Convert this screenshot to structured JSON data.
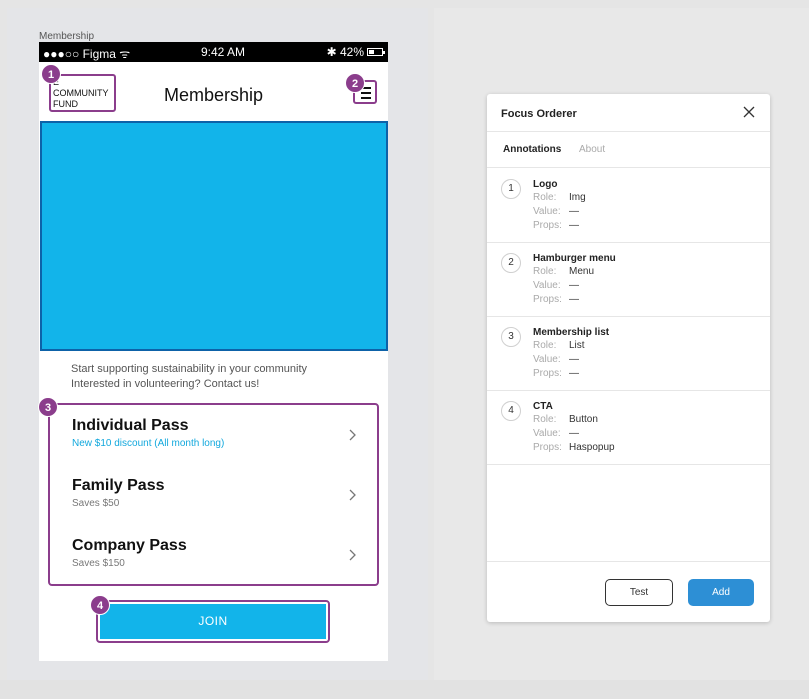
{
  "frame_label": "Membership",
  "statusbar": {
    "carrier": "●●●○○ Figma ᯤ",
    "time": "9:42 AM",
    "battery": "✱ 42%",
    "battery_level": 0.42
  },
  "header": {
    "logo_lines": [
      "E",
      "COMMUNITY",
      "FUND"
    ],
    "title": "Membership"
  },
  "intro": {
    "line1": "Start supporting sustainability in your community",
    "line2": "Interested in volunteering? Contact us!"
  },
  "passes": [
    {
      "title": "Individual Pass",
      "subtitle": "New $10 discount (All month long)"
    },
    {
      "title": "Family Pass",
      "subtitle": "Saves $50"
    },
    {
      "title": "Company Pass",
      "subtitle": "Saves $150"
    }
  ],
  "join_label": "JOIN",
  "badges": [
    "1",
    "2",
    "3",
    "4"
  ],
  "panel": {
    "title": "Focus Orderer",
    "tabs": [
      "Annotations",
      "About"
    ],
    "annotations": [
      {
        "num": "1",
        "name": "Logo",
        "role": "Img",
        "value": "—",
        "props": "—"
      },
      {
        "num": "2",
        "name": "Hamburger menu",
        "role": "Menu",
        "value": "—",
        "props": "—"
      },
      {
        "num": "3",
        "name": "Membership list",
        "role": "List",
        "value": "—",
        "props": "—"
      },
      {
        "num": "4",
        "name": "CTA",
        "role": "Button",
        "value": "—",
        "props": "Haspopup"
      }
    ],
    "labels": {
      "role": "Role:",
      "value": "Value:",
      "props": "Props:"
    },
    "test_label": "Test",
    "add_label": "Add"
  },
  "colors": {
    "accent": "#12b4ea",
    "annotation": "#8b3d8c",
    "primary_button": "#2d8fd5"
  }
}
